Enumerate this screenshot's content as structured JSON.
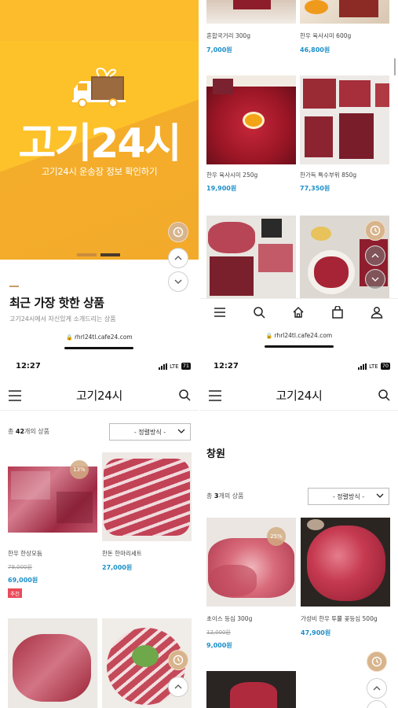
{
  "panel1": {
    "brand_big": "고기24시",
    "banner_subtitle": "고기24시 운송장 정보 확인하기",
    "section_title": "최근 가장 핫한 상품",
    "section_desc": "고기24시에서 자신있게 소개드리는 상품",
    "url": "rhrl24tl.cafe24.com"
  },
  "panel2": {
    "products": [
      {
        "name": "혼합국거리 300g",
        "price": "7,000원"
      },
      {
        "name": "한우 육사시미 600g",
        "price": "46,800원"
      },
      {
        "name": "한우 육사시미 250g",
        "price": "19,900원"
      },
      {
        "name": "한가득 특수부위 850g",
        "price": "77,350원"
      }
    ],
    "url": "rhrl24tl.cafe24.com"
  },
  "panel3": {
    "time": "12:27",
    "network": "LTE",
    "battery": "71",
    "title": "고기24시",
    "count_prefix": "총 ",
    "count_num": "42",
    "count_suffix": "개의 상품",
    "sort_label": "- 정렬방식 -",
    "products": [
      {
        "name": "한우 한상모듬",
        "old_price": "79,000원",
        "price": "69,000원",
        "badge": "13%",
        "tag": "추천"
      },
      {
        "name": "한돈 한마리세트",
        "price": "27,000원"
      }
    ]
  },
  "panel4": {
    "time": "12:27",
    "network": "LTE",
    "battery": "70",
    "title": "고기24시",
    "category": "창원",
    "count_prefix": "총 ",
    "count_num": "3",
    "count_suffix": "개의 상품",
    "sort_label": "- 정렬방식 -",
    "products": [
      {
        "name": "초이스 등심 300g",
        "old_price": "12,000원",
        "price": "9,000원",
        "badge": "25%"
      },
      {
        "name": "가성비 한우 투뿔 꽃등심 500g",
        "price": "47,900원"
      }
    ]
  },
  "colors": {
    "banner": "#f7b52a",
    "price": "#1d8fc7",
    "badge": "#d2ac82",
    "tag": "#e94a58"
  }
}
